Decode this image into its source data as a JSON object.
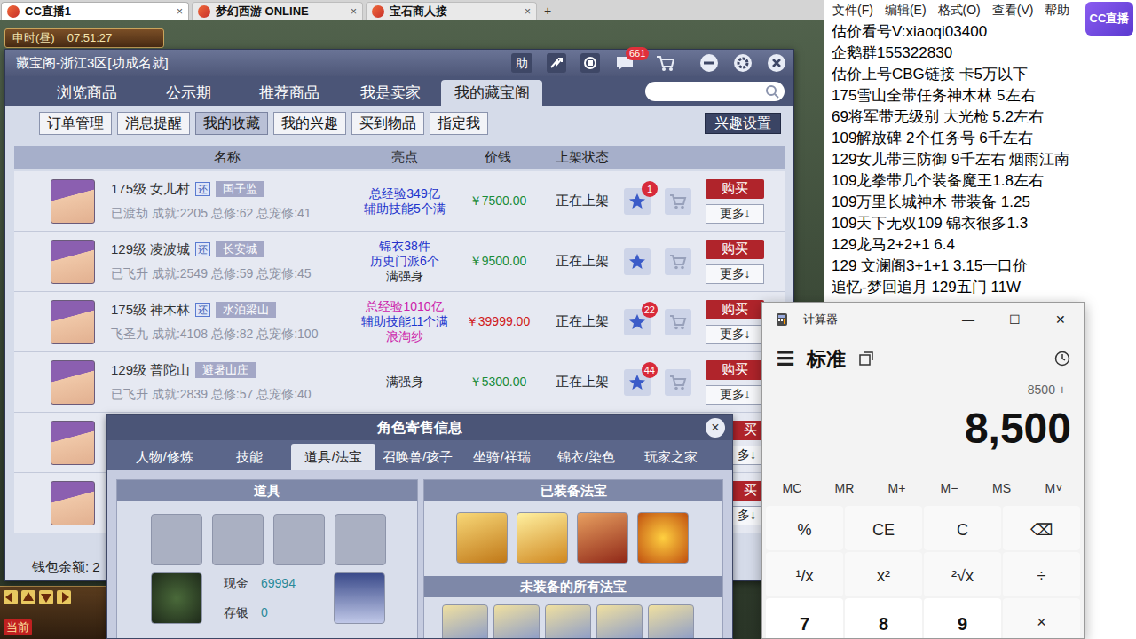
{
  "browser": {
    "tabs": [
      {
        "label": "CC直播1",
        "close": "×",
        "selected": true
      },
      {
        "label": "梦幻西游 ONLINE",
        "close": "×",
        "selected": false
      },
      {
        "label": "宝石商人接",
        "close": "×",
        "selected": false
      }
    ],
    "new_tab": "+"
  },
  "game": {
    "period": "申时(昼)",
    "clock": "07:51:27",
    "chat_channel": "当前"
  },
  "panel": {
    "title": "藏宝阁-浙江3区[功成名就]",
    "help": "助",
    "messages_badge": "661",
    "tabs": [
      {
        "label": "浏览商品",
        "selected": false
      },
      {
        "label": "公示期",
        "selected": false
      },
      {
        "label": "推荐商品",
        "selected": false
      },
      {
        "label": "我是卖家",
        "selected": false
      },
      {
        "label": "我的藏宝阁",
        "selected": true
      }
    ],
    "subtabs": [
      {
        "label": "订单管理",
        "selected": false
      },
      {
        "label": "消息提醒",
        "selected": false
      },
      {
        "label": "我的收藏",
        "selected": true
      },
      {
        "label": "我的兴趣",
        "selected": false
      },
      {
        "label": "买到物品",
        "selected": false
      },
      {
        "label": "指定我",
        "selected": false
      }
    ],
    "interest_settings": "兴趣设置",
    "columns": [
      "名称",
      "亮点",
      "价钱",
      "上架状态"
    ],
    "rows": [
      {
        "kind": "full",
        "name": "175级 女儿村",
        "return_tag": "还",
        "server": "国子监",
        "stats": "已渡劫 成就:2205 总修:62 总宠修:41",
        "highlights": [
          {
            "text": "总经验349亿",
            "color": "#2233cc"
          },
          {
            "text": "辅助技能5个满",
            "color": "#2233cc"
          }
        ],
        "price": "￥7500.00",
        "price_color": "#1a8c3a",
        "status": "正在上架",
        "favorites": "1",
        "buy": "购买",
        "more": "更多↓"
      },
      {
        "kind": "full",
        "name": "129级 凌波城",
        "return_tag": "还",
        "server": "长安城",
        "stats": "已飞升 成就:2549 总修:59 总宠修:45",
        "highlights": [
          {
            "text": "锦衣38件",
            "color": "#2233cc"
          },
          {
            "text": "历史门派6个",
            "color": "#2233cc"
          },
          {
            "text": "满强身",
            "color": "#222222"
          }
        ],
        "price": "￥9500.00",
        "price_color": "#1a8c3a",
        "status": "正在上架",
        "buy": "购买",
        "more": "更多↓"
      },
      {
        "kind": "full",
        "name": "175级 神木林",
        "return_tag": "还",
        "server": "水泊梁山",
        "stats": "飞圣九 成就:4108 总修:82 总宠修:100",
        "highlights": [
          {
            "text": "总经验1010亿",
            "color": "#cc22aa"
          },
          {
            "text": "辅助技能11个满",
            "color": "#2233cc"
          },
          {
            "text": "浪淘纱",
            "color": "#cc22aa"
          }
        ],
        "price": "￥39999.00",
        "price_color": "#d01c1c",
        "status": "正在上架",
        "favorites": "22",
        "buy": "购买",
        "more": "更多↓"
      },
      {
        "kind": "full",
        "name": "129级 普陀山",
        "server": "避暑山庄",
        "stats": "已飞升 成就:2839 总修:57 总宠修:40",
        "highlights": [
          {
            "text": "满强身",
            "color": "#222222"
          }
        ],
        "price": "￥5300.00",
        "price_color": "#1a8c3a",
        "status": "正在上架",
        "favorites": "44",
        "buy": "购买",
        "more": "更多↓"
      },
      {
        "kind": "partial",
        "buy": "买",
        "more": "多↓"
      },
      {
        "kind": "partial",
        "buy": "买",
        "more": "多↓"
      }
    ],
    "wallet": "钱包余额: 2"
  },
  "sale_info": {
    "title": "角色寄售信息",
    "close": "×",
    "tabs": [
      {
        "label": "人物/修炼",
        "selected": false
      },
      {
        "label": "技能",
        "selected": false
      },
      {
        "label": "道具/法宝",
        "selected": true
      },
      {
        "label": "召唤兽/孩子",
        "selected": false
      },
      {
        "label": "坐骑/祥瑞",
        "selected": false
      },
      {
        "label": "锦衣/染色",
        "selected": false
      },
      {
        "label": "玩家之家",
        "selected": false
      }
    ],
    "items_header": "道具",
    "cash_label": "现金",
    "cash": "69994",
    "deposit_label": "存银",
    "deposit": "0",
    "equipped_header": "已装备法宝",
    "unequipped_header": "未装备的所有法宝"
  },
  "calculator": {
    "title": "计算器",
    "controls": [
      "—",
      "☐",
      "✕"
    ],
    "menu": "☰",
    "mode": "标准",
    "expression": "8500 +",
    "display": "8,500",
    "memory": [
      "MC",
      "MR",
      "M+",
      "M−",
      "MS",
      "M˅"
    ],
    "keys": [
      [
        "%",
        "CE",
        "C",
        "⌫"
      ],
      [
        "¹/x",
        "x²",
        "²√x",
        "÷"
      ],
      [
        "7",
        "8",
        "9",
        "×"
      ]
    ]
  },
  "notepad": {
    "menu": [
      "文件(F)",
      "编辑(E)",
      "格式(O)",
      "查看(V)",
      "帮助"
    ],
    "lines": [
      "估价看号V:xiaoqi03400",
      "企鹅群155322830",
      "估价上号CBG链接 卡5万以下",
      "175雪山全带任务神木林 5左右",
      "69将军带无级别 大光枪 5.2左右",
      "109解放碑 2个任务号 6千左右",
      "129女儿带三防御 9千左右 烟雨江南",
      "109龙拳带几个装备魔王1.8左右",
      "109万里长城神木 带装备 1.25",
      "109天下无双109 锦衣很多1.3",
      "129龙马2+2+1 6.4",
      "129 文澜阁3+1+1 3.15一口价",
      "追忆-梦回追月 129五门 11W"
    ]
  },
  "logo": "CC直播"
}
